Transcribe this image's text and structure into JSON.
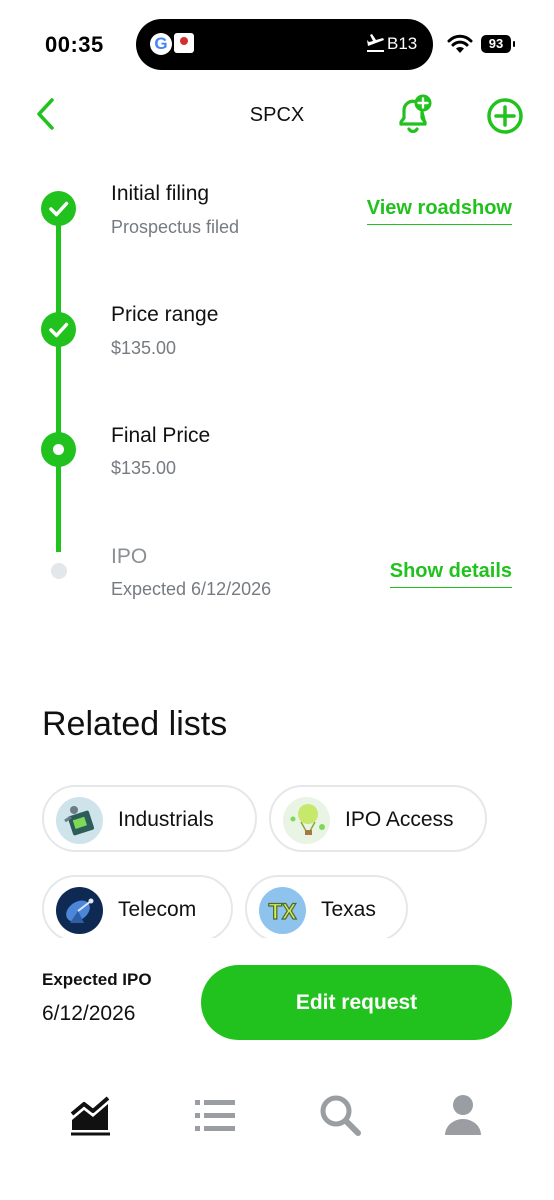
{
  "status_bar": {
    "time": "00:35",
    "gate": "B13",
    "battery": "93",
    "icons": [
      "google-icon",
      "app-icon",
      "plane-icon",
      "wifi-icon",
      "battery-icon"
    ]
  },
  "header": {
    "title": "SPCX",
    "icons": [
      "back-chevron-icon",
      "bell-plus-icon",
      "plus-circle-icon"
    ]
  },
  "timeline": {
    "steps": [
      {
        "title": "Initial filing",
        "subtitle": "Prospectus filed",
        "status": "complete",
        "link": "View roadshow"
      },
      {
        "title": "Price range",
        "subtitle": "$135.00",
        "status": "complete"
      },
      {
        "title": "Final Price",
        "subtitle": "$135.00",
        "status": "current"
      },
      {
        "title": "IPO",
        "subtitle": "Expected 6/12/2026",
        "status": "pending",
        "link": "Show details"
      }
    ]
  },
  "related": {
    "heading": "Related lists",
    "chips": [
      {
        "label": "Industrials",
        "icon": "industrials-icon"
      },
      {
        "label": "IPO Access",
        "icon": "ipo-access-icon"
      },
      {
        "label": "Telecom",
        "icon": "telecom-icon"
      },
      {
        "label": "Texas",
        "icon": "texas-icon",
        "icon_text": "TX"
      }
    ]
  },
  "footer": {
    "expected_label": "Expected IPO",
    "expected_value": "6/12/2026",
    "button_label": "Edit request"
  },
  "tabs": [
    {
      "name": "investing",
      "icon": "chart-icon",
      "active": true
    },
    {
      "name": "lists",
      "icon": "list-icon",
      "active": false
    },
    {
      "name": "search",
      "icon": "search-icon",
      "active": false
    },
    {
      "name": "account",
      "icon": "person-icon",
      "active": false
    }
  ],
  "colors": {
    "accent": "#21c21d",
    "muted_text": "#767b81",
    "pending_dot": "#e3e6ea",
    "inactive_tab": "#9a9da1"
  }
}
